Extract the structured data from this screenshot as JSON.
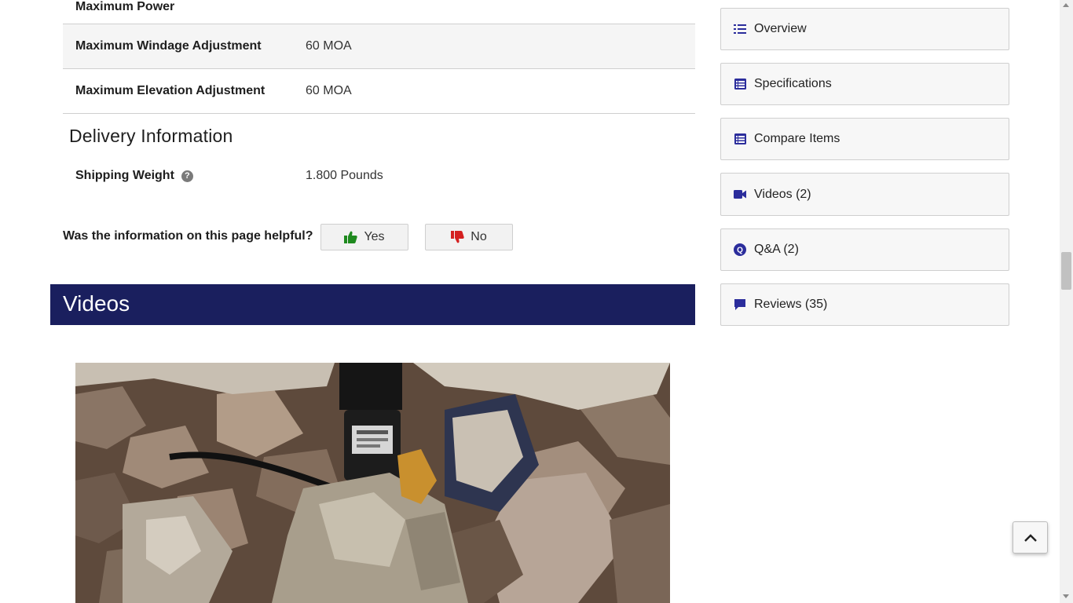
{
  "specs": {
    "rows": [
      {
        "label": "Maximum Power",
        "value": ""
      },
      {
        "label": "Maximum Windage Adjustment",
        "value": "60 MOA"
      },
      {
        "label": "Maximum Elevation Adjustment",
        "value": "60 MOA"
      }
    ]
  },
  "delivery": {
    "heading": "Delivery Information",
    "shipping_label": "Shipping Weight",
    "help_glyph": "?",
    "shipping_value": "1.800 Pounds"
  },
  "helpful": {
    "question": "Was the information on this page helpful?",
    "yes_label": "Yes",
    "no_label": "No"
  },
  "videos": {
    "heading": "Videos"
  },
  "nav": {
    "items": [
      {
        "label": "Overview",
        "icon": "list-icon"
      },
      {
        "label": "Specifications",
        "icon": "table-list-icon"
      },
      {
        "label": "Compare Items",
        "icon": "table-list-icon"
      },
      {
        "label": "Videos (2)",
        "icon": "video-camera-icon"
      },
      {
        "label": "Q&A (2)",
        "icon": "qa-icon"
      },
      {
        "label": "Reviews (35)",
        "icon": "comment-icon"
      }
    ]
  },
  "colors": {
    "band": "#1a1f5e",
    "icon_blue": "#2b2d9c",
    "thumbs_up": "#1f8a1f",
    "thumbs_down": "#d42020"
  }
}
